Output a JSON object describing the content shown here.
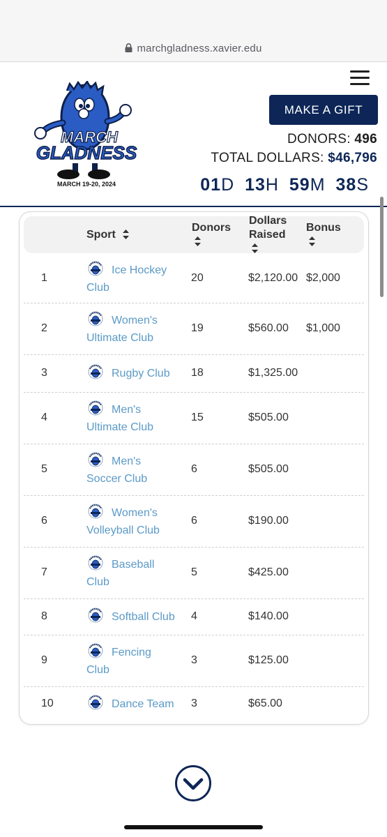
{
  "browser": {
    "url": "marchgladness.xavier.edu"
  },
  "logo": {
    "line1": "MARCH",
    "line2": "GLADNESS",
    "dates": "MARCH 19-20, 2024"
  },
  "header": {
    "gift_label": "MAKE A GIFT",
    "donors_label": "DONORS:",
    "donors_value": "496",
    "dollars_label": "TOTAL DOLLARS:",
    "dollars_value": "$46,796",
    "countdown": {
      "days": "01",
      "days_unit": "D",
      "hours": "13",
      "hours_unit": "H",
      "minutes": "59",
      "minutes_unit": "M",
      "seconds": "38",
      "seconds_unit": "S"
    }
  },
  "table": {
    "headers": {
      "sport": "Sport",
      "donors": "Donors",
      "dollars_line1": "Dollars",
      "dollars_line2": "Raised",
      "bonus": "Bonus"
    },
    "rows": [
      {
        "rank": "1",
        "sport_a": "Ice Hockey",
        "sport_b": "Club",
        "donors": "20",
        "raised": "$2,120.00",
        "bonus": "$2,000"
      },
      {
        "rank": "2",
        "sport_a": "Women's",
        "sport_b": "Ultimate Club",
        "donors": "19",
        "raised": "$560.00",
        "bonus": "$1,000"
      },
      {
        "rank": "3",
        "sport_a": "Rugby Club",
        "sport_b": "",
        "donors": "18",
        "raised": "$1,325.00",
        "bonus": ""
      },
      {
        "rank": "4",
        "sport_a": "Men's",
        "sport_b": "Ultimate Club",
        "donors": "15",
        "raised": "$505.00",
        "bonus": ""
      },
      {
        "rank": "5",
        "sport_a": "Men's",
        "sport_b": "Soccer Club",
        "donors": "6",
        "raised": "$505.00",
        "bonus": ""
      },
      {
        "rank": "6",
        "sport_a": "Women's",
        "sport_b": "Volleyball Club",
        "donors": "6",
        "raised": "$190.00",
        "bonus": ""
      },
      {
        "rank": "7",
        "sport_a": "Baseball",
        "sport_b": "Club",
        "donors": "5",
        "raised": "$425.00",
        "bonus": ""
      },
      {
        "rank": "8",
        "sport_a": "Softball Club",
        "sport_b": "",
        "donors": "4",
        "raised": "$140.00",
        "bonus": ""
      },
      {
        "rank": "9",
        "sport_a": "Fencing",
        "sport_b": "Club",
        "donors": "3",
        "raised": "$125.00",
        "bonus": ""
      },
      {
        "rank": "10",
        "sport_a": "Dance Team",
        "sport_b": "",
        "donors": "3",
        "raised": "$65.00",
        "bonus": ""
      }
    ]
  },
  "icons": {
    "lock": "lock-icon",
    "menu": "hamburger-menu-icon",
    "sort": "sort-arrows-icon",
    "badge": "team-badge-icon",
    "scroll_down": "chevron-down-circle-icon"
  },
  "colors": {
    "navy": "#0d2657",
    "link_blue": "#5b9ac7",
    "mascot_blue": "#2a5cc4"
  }
}
